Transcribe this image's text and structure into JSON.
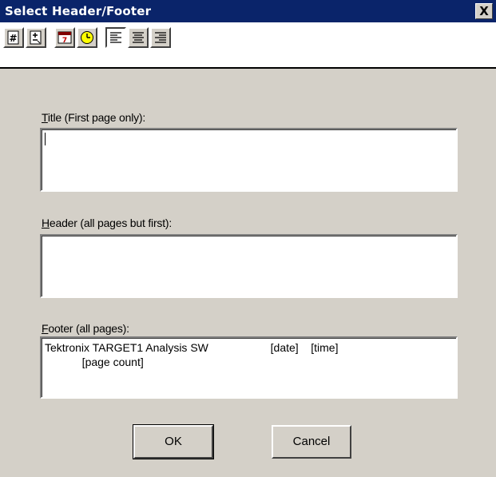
{
  "window": {
    "title": "Select Header/Footer",
    "close_label": "X"
  },
  "toolbar": {
    "buttons": [
      {
        "icon": "page-number-icon"
      },
      {
        "icon": "page-count-icon"
      },
      {
        "icon": "calendar-date-icon"
      },
      {
        "icon": "clock-time-icon"
      },
      {
        "icon": "align-left-icon"
      },
      {
        "icon": "align-center-icon"
      },
      {
        "icon": "align-right-icon"
      }
    ]
  },
  "fields": {
    "title": {
      "label": "Title (First page only):",
      "mnemonic": "T",
      "rest": "itle (First page only):",
      "value": ""
    },
    "header": {
      "label": "Header (all pages but first):",
      "mnemonic": "H",
      "rest": "eader (all pages but first):",
      "value": ""
    },
    "footer": {
      "label": "Footer (all pages):",
      "mnemonic": "F",
      "rest": "ooter (all pages):",
      "value": "Tektronix TARGET1 Analysis SW                    [date]    [time]\n            [page count]"
    }
  },
  "buttons": {
    "ok": "OK",
    "cancel": "Cancel"
  },
  "colors": {
    "titlebar": "#0a246a",
    "dialog": "#d4d0c8"
  }
}
